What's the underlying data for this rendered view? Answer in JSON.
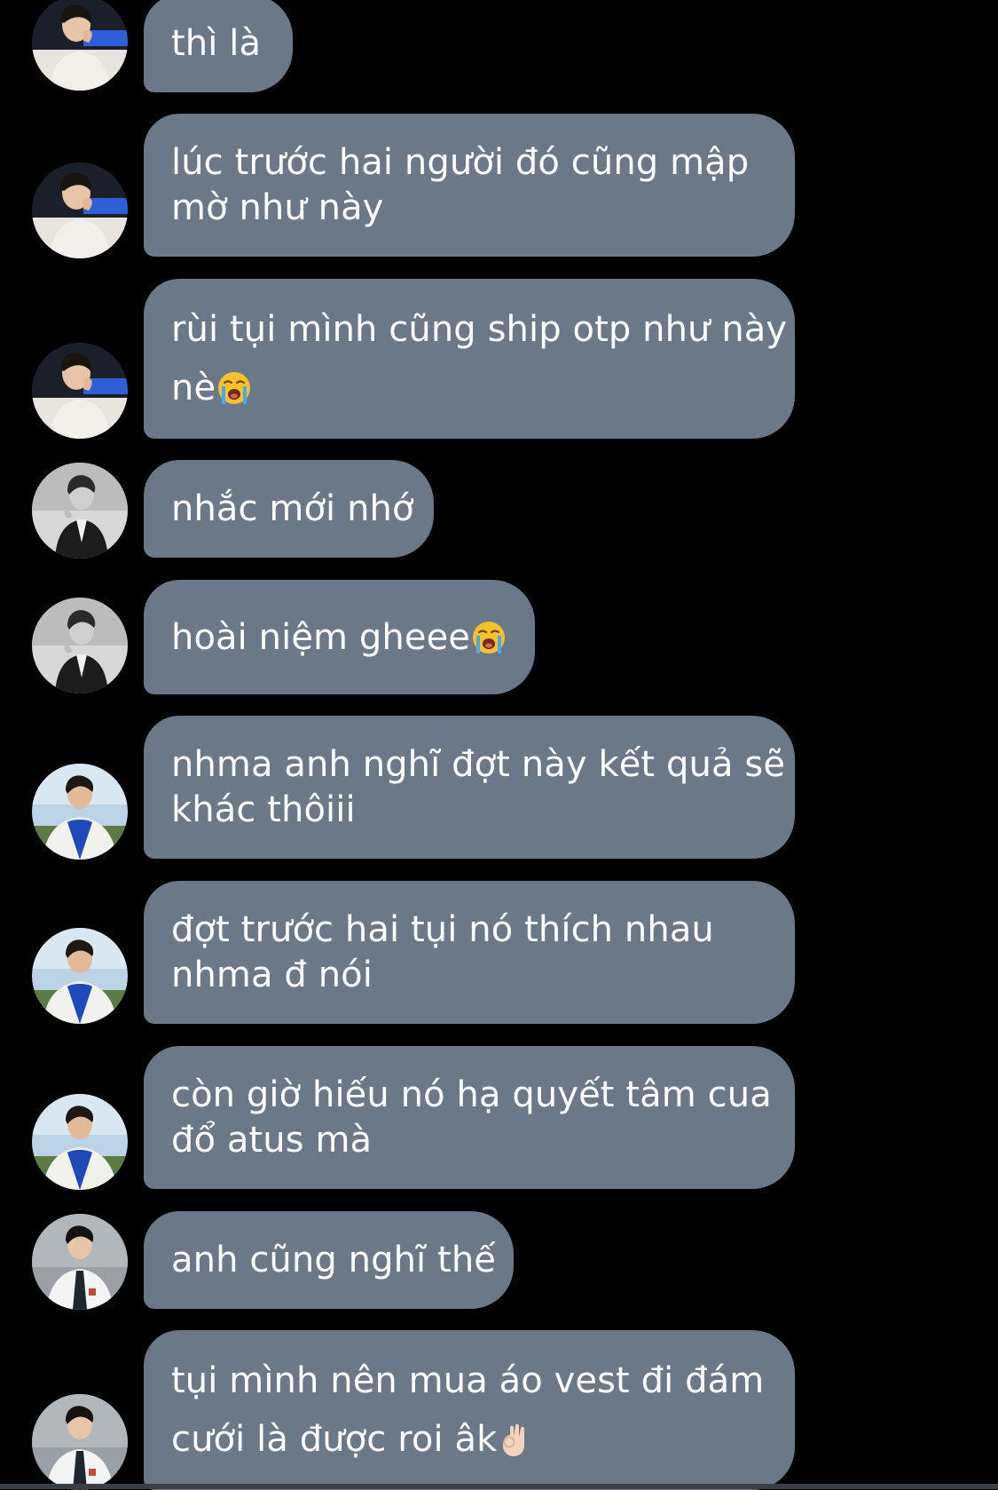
{
  "messages": [
    {
      "sender": "user-a",
      "lines": [
        "thì là"
      ],
      "emoji": ""
    },
    {
      "sender": "user-a",
      "lines": [
        "lúc trước hai người đó cũng mập",
        "mờ như này"
      ],
      "emoji": ""
    },
    {
      "sender": "user-a",
      "lines": [
        "rùi tụi mình cũng ship otp như này",
        "nè"
      ],
      "emoji": "loudly-crying-face"
    },
    {
      "sender": "user-b",
      "lines": [
        "nhắc mới nhớ"
      ],
      "emoji": ""
    },
    {
      "sender": "user-b",
      "lines": [
        "hoài niệm gheee"
      ],
      "emoji": "loudly-crying-face"
    },
    {
      "sender": "user-c",
      "lines": [
        "nhma anh nghĩ đợt này kết quả sẽ",
        "khác thôiii"
      ],
      "emoji": ""
    },
    {
      "sender": "user-c",
      "lines": [
        "đợt trước hai tụi nó thích nhau",
        "nhma đ nói"
      ],
      "emoji": ""
    },
    {
      "sender": "user-c",
      "lines": [
        "còn giờ hiếu nó hạ quyết tâm cua",
        "đổ atus mà"
      ],
      "emoji": ""
    },
    {
      "sender": "user-d",
      "lines": [
        "anh cũng nghĩ thế"
      ],
      "emoji": ""
    },
    {
      "sender": "user-d",
      "lines": [
        "tụi mình nên mua áo vest đi đám",
        "cưới là được roi âk"
      ],
      "emoji": "ok-hand-light-skin-tone"
    }
  ],
  "colors": {
    "background": "#000000",
    "bubble": "#6b7888",
    "text": "#ffffff"
  }
}
